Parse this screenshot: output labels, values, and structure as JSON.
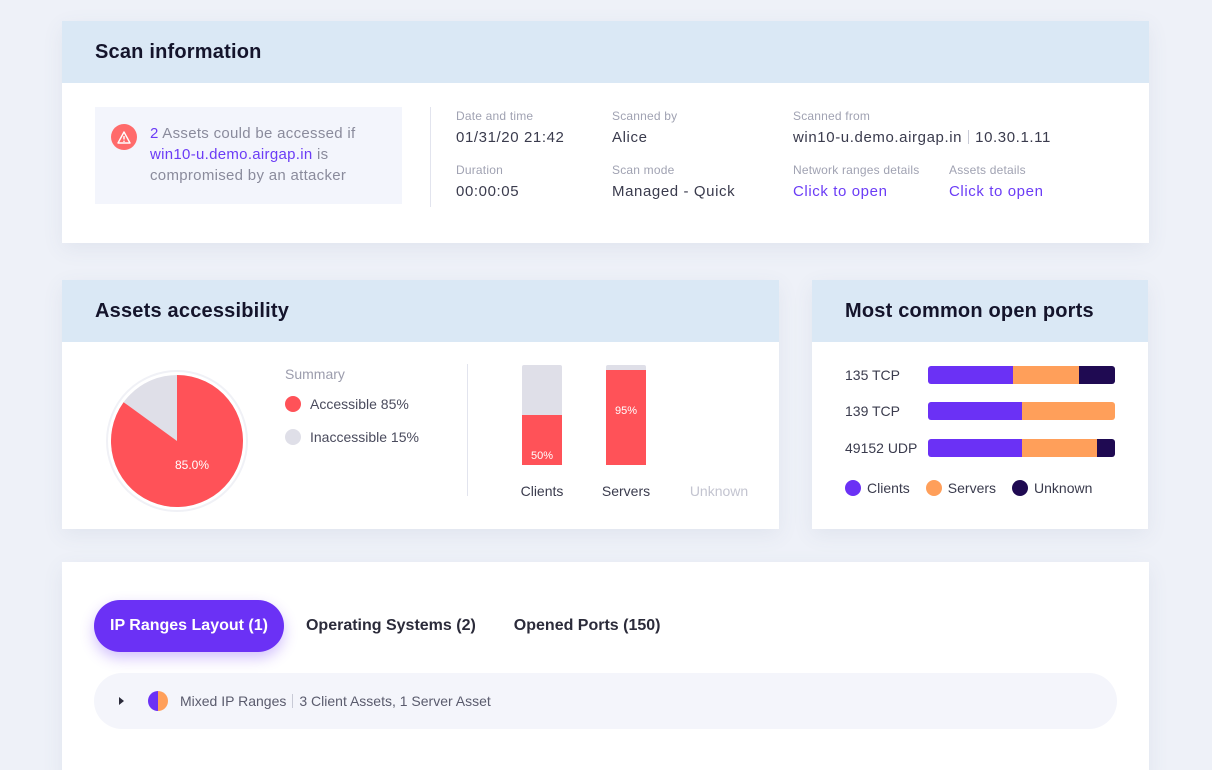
{
  "scan_info": {
    "title": "Scan information",
    "alert": {
      "count": "2",
      "text_1": " Assets could be accessed if",
      "host": "win10-u.demo.airgap.in",
      "text_2": " is compromised by an attacker"
    },
    "fields": {
      "date_label": "Date and time",
      "date_value": "01/31/20 21:42",
      "scanned_by_label": "Scanned by",
      "scanned_by_value": "Alice",
      "scanned_from_label": "Scanned from",
      "scanned_from_host": "win10-u.demo.airgap.in",
      "scanned_from_ip": "10.30.1.11",
      "duration_label": "Duration",
      "duration_value": "00:00:05",
      "scan_mode_label": "Scan mode",
      "scan_mode_value": "Managed - Quick",
      "network_label": "Network ranges details",
      "network_link": "Click to open",
      "assets_label": "Assets details",
      "assets_link": "Click to open"
    }
  },
  "accessibility": {
    "title": "Assets accessibility",
    "pie_label": "85.0%",
    "pie_accessible_fraction": 0.85,
    "summary_title": "Summary",
    "legend": [
      {
        "label": "Accessible 85%",
        "color": "#ff5258"
      },
      {
        "label": "Inaccessible 15%",
        "color": "#dfdfe8"
      }
    ],
    "bars": [
      {
        "category": "Clients",
        "value": 50,
        "label": "50%"
      },
      {
        "category": "Servers",
        "value": 95,
        "label": "95%"
      },
      {
        "category": "Unknown",
        "value": null,
        "label": ""
      }
    ]
  },
  "ports": {
    "title": "Most common open ports",
    "colors": {
      "clients": "#6b31f5",
      "servers": "#ff9f5a",
      "unknown": "#1f0a52"
    },
    "rows": [
      {
        "name": "135 TCP",
        "clients": 0.455,
        "servers": 0.35,
        "unknown": 0.195
      },
      {
        "name": "139 TCP",
        "clients": 0.505,
        "servers": 0.495,
        "unknown": 0
      },
      {
        "name": "49152 UDP",
        "clients": 0.505,
        "servers": 0.4,
        "unknown": 0.095
      }
    ],
    "legend": [
      {
        "label": "Clients",
        "color": "#6b31f5"
      },
      {
        "label": "Servers",
        "color": "#ff9f5a"
      },
      {
        "label": "Unknown",
        "color": "#1f0a52"
      }
    ]
  },
  "tabs": [
    {
      "label": "IP Ranges Layout (1)",
      "active": true
    },
    {
      "label": "Operating Systems (2)",
      "active": false
    },
    {
      "label": "Opened Ports (150)",
      "active": false
    }
  ],
  "range_row": {
    "name": "Mixed IP Ranges",
    "details": "3 Client Assets, 1 Server Asset"
  }
}
